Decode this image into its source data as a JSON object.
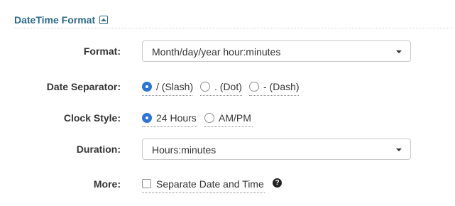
{
  "section": {
    "title": "DateTime Format",
    "collapse_icon": "chevron-up-icon"
  },
  "format": {
    "label": "Format:",
    "value": "Month/day/year hour:minutes"
  },
  "date_separator": {
    "label": "Date Separator:",
    "options": [
      {
        "label": "/ (Slash)",
        "selected": true
      },
      {
        "label": ". (Dot)",
        "selected": false
      },
      {
        "label": "- (Dash)",
        "selected": false
      }
    ]
  },
  "clock_style": {
    "label": "Clock Style:",
    "options": [
      {
        "label": "24 Hours",
        "selected": true
      },
      {
        "label": "AM/PM",
        "selected": false
      }
    ]
  },
  "duration": {
    "label": "Duration:",
    "value": "Hours:minutes"
  },
  "more": {
    "label": "More:",
    "checkbox_label": "Separate Date and Time",
    "checked": false,
    "help_icon": "?"
  },
  "colors": {
    "section_title": "#2e6b8a",
    "radio_selected": "#2d74d8"
  }
}
